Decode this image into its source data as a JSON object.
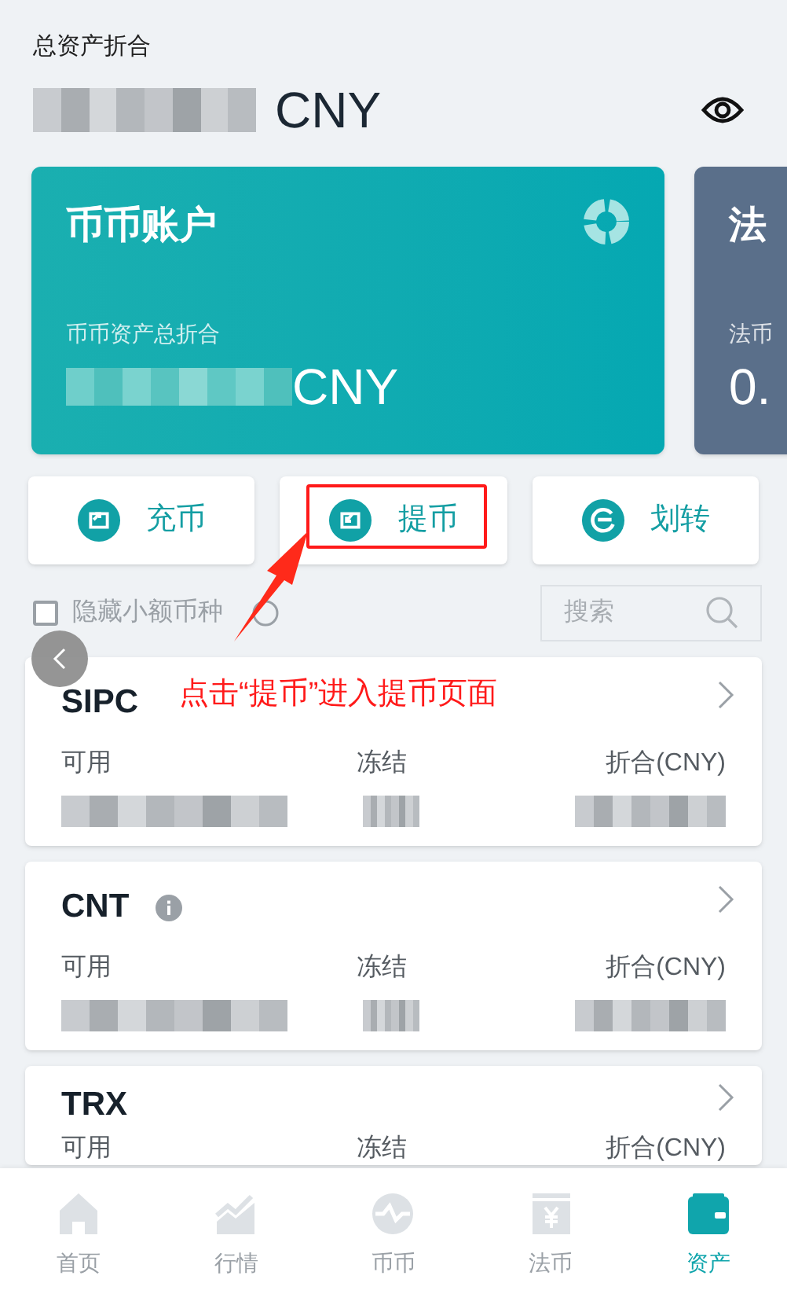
{
  "total": {
    "label": "总资产折合",
    "currency": "CNY"
  },
  "accounts": [
    {
      "kind": "spot",
      "title": "币币账户",
      "subtitle": "币币资产总折合",
      "currency": "CNY"
    },
    {
      "kind": "fiat",
      "title": "法",
      "subtitle": "法币",
      "value": "0."
    }
  ],
  "actions": [
    {
      "kind": "deposit",
      "label": "充币",
      "highlighted": false
    },
    {
      "kind": "withdraw",
      "label": "提币",
      "highlighted": true
    },
    {
      "kind": "transfer",
      "label": "划转",
      "highlighted": false
    }
  ],
  "filter": {
    "label": "隐藏小额币种",
    "checked": false
  },
  "search": {
    "placeholder": "搜索"
  },
  "annotation": {
    "text": "点击“提币”进入提币页面"
  },
  "coins": [
    {
      "symbol": "SIPC",
      "info": false,
      "masked": true,
      "columns": [
        "可用",
        "冻结",
        "折合(CNY)"
      ]
    },
    {
      "symbol": "CNT",
      "info": true,
      "masked": true,
      "columns": [
        "可用",
        "冻结",
        "折合(CNY)"
      ]
    },
    {
      "symbol": "TRX",
      "info": false,
      "masked": false,
      "columns": [
        "可用",
        "冻结",
        "折合(CNY)"
      ]
    }
  ],
  "nav": [
    {
      "kind": "home",
      "label": "首页",
      "selected": false
    },
    {
      "kind": "market",
      "label": "行情",
      "selected": false
    },
    {
      "kind": "spot",
      "label": "币币",
      "selected": false
    },
    {
      "kind": "fiat",
      "label": "法币",
      "selected": false
    },
    {
      "kind": "assets",
      "label": "资产",
      "selected": true
    }
  ]
}
